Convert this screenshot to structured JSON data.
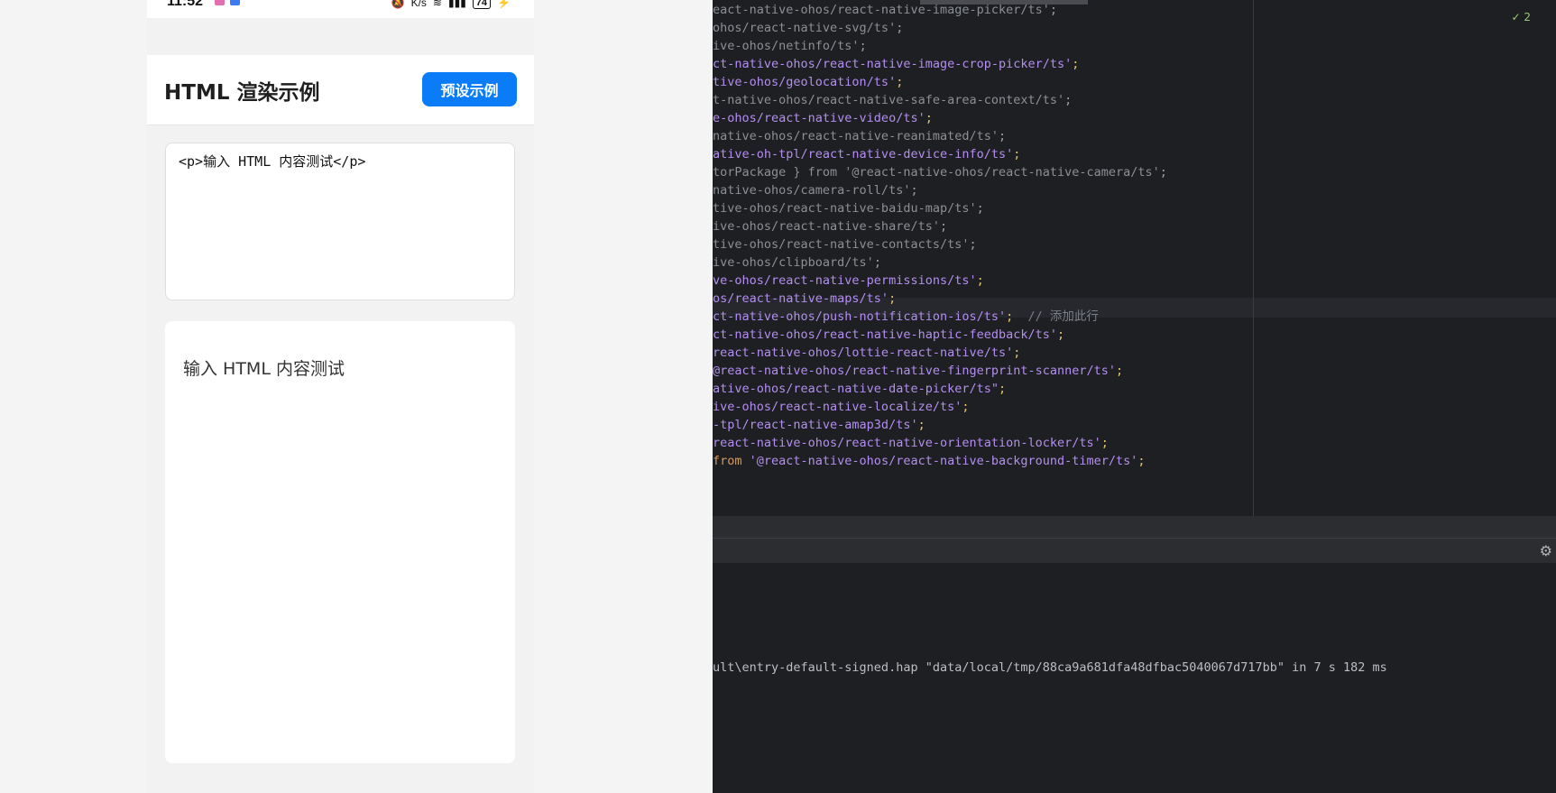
{
  "phone": {
    "status_time": "11:52",
    "status_speed": "K/s",
    "battery": "74",
    "title": "HTML 渲染示例",
    "preset_button": "预设示例",
    "input_value": "<p>输入 HTML 内容测试</p>",
    "rendered_text": "输入 HTML 内容测试"
  },
  "ide": {
    "inspection_count": "2",
    "code_lines": [
      {
        "text": "eact-native-ohos/react-native-image-picker/ts'",
        "style": "gray",
        "punct": ";"
      },
      {
        "text": "ohos/react-native-svg/ts'",
        "style": "gray",
        "punct": ";"
      },
      {
        "text": "ive-ohos/netinfo/ts'",
        "style": "gray",
        "punct": ";"
      },
      {
        "text": "ct-native-ohos/react-native-image-crop-picker/ts'",
        "style": "purple",
        "punct": ";"
      },
      {
        "text": "tive-ohos/geolocation/ts'",
        "style": "purple",
        "punct": ";"
      },
      {
        "text": "t-native-ohos/react-native-safe-area-context/ts'",
        "style": "gray",
        "punct": ";"
      },
      {
        "text": "e-ohos/react-native-video/ts'",
        "style": "purple",
        "punct": ";"
      },
      {
        "text": "native-ohos/react-native-reanimated/ts'",
        "style": "gray",
        "punct": ";"
      },
      {
        "text": "ative-oh-tpl/react-native-device-info/ts'",
        "style": "purple",
        "punct": ";"
      },
      {
        "text": "torPackage } from '@react-native-ohos/react-native-camera/ts'",
        "style": "gray",
        "punct": ";"
      },
      {
        "text": "native-ohos/camera-roll/ts'",
        "style": "gray",
        "punct": ";"
      },
      {
        "text": "tive-ohos/react-native-baidu-map/ts'",
        "style": "gray",
        "punct": ";"
      },
      {
        "text": "ive-ohos/react-native-share/ts'",
        "style": "gray",
        "punct": ";"
      },
      {
        "text": "tive-ohos/react-native-contacts/ts'",
        "style": "gray",
        "punct": ";"
      },
      {
        "text": "ive-ohos/clipboard/ts'",
        "style": "gray",
        "punct": ";"
      },
      {
        "text": "ve-ohos/react-native-permissions/ts'",
        "style": "purple",
        "punct": ";"
      },
      {
        "text": "os/react-native-maps/ts'",
        "style": "purple",
        "punct": ";"
      },
      {
        "text": "ct-native-ohos/push-notification-ios/ts'",
        "style": "purple",
        "punct": ";",
        "comment": "  // 添加此行"
      },
      {
        "text": "ct-native-ohos/react-native-haptic-feedback/ts'",
        "style": "purple",
        "punct": ";"
      },
      {
        "text": "react-native-ohos/lottie-react-native/ts'",
        "style": "purple",
        "punct": ";"
      },
      {
        "text": "@react-native-ohos/react-native-fingerprint-scanner/ts'",
        "style": "purple",
        "punct": ";"
      },
      {
        "text": "ative-ohos/react-native-date-picker/ts\"",
        "style": "purple",
        "punct": ";"
      },
      {
        "text": "ive-ohos/react-native-localize/ts'",
        "style": "purple",
        "punct": ";"
      },
      {
        "text": "-tpl/react-native-amap3d/ts'",
        "style": "purple",
        "punct": ";"
      },
      {
        "text": "react-native-ohos/react-native-orientation-locker/ts'",
        "style": "purple",
        "punct": ";"
      },
      {
        "text": "'@react-native-ohos/react-native-background-timer/ts'",
        "style": "purple",
        "punct": ";",
        "prefix": "from "
      }
    ],
    "log_line": "ult\\entry-default-signed.hap \"data/local/tmp/88ca9a681dfa48dfbac5040067d717bb\" in 7 s 182 ms"
  },
  "colors": {
    "accent": "#0a7cf7",
    "ide_bg": "#1e1f22",
    "string_purple": "#b48ef0"
  }
}
